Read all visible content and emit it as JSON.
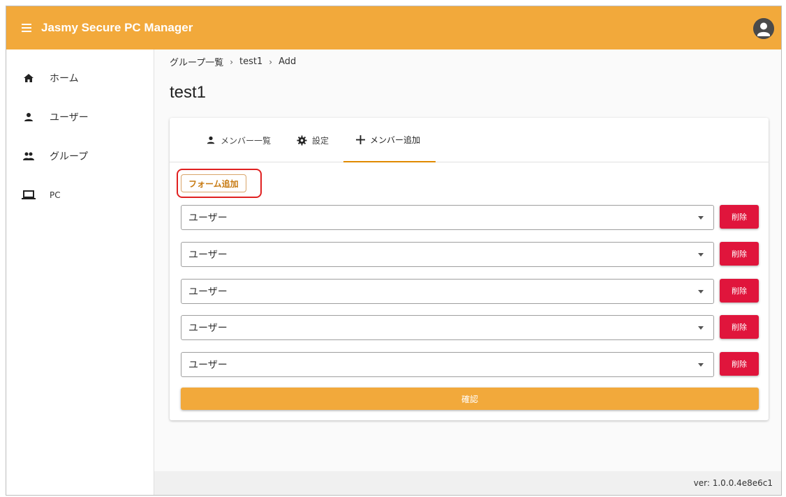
{
  "header": {
    "app_title": "Jasmy Secure PC Manager",
    "menu_icon": "hamburger-menu-icon",
    "avatar_icon": "account-circle-icon",
    "bar_color": "#f2a93b"
  },
  "sidebar": {
    "items": [
      {
        "label": "ホーム",
        "icon": "home-icon"
      },
      {
        "label": "ユーザー",
        "icon": "person-icon"
      },
      {
        "label": "グループ",
        "icon": "people-icon"
      },
      {
        "label": "PC",
        "icon": "laptop-icon"
      }
    ]
  },
  "breadcrumb": {
    "items": [
      "グループ一覧",
      "test1",
      "Add"
    ],
    "separator": "›"
  },
  "page": {
    "title": "test1"
  },
  "tabs": [
    {
      "label": "メンバー一覧",
      "icon": "person-icon"
    },
    {
      "label": "設定",
      "icon": "gear-icon"
    },
    {
      "label": "メンバー追加",
      "icon": "plus-icon"
    }
  ],
  "form": {
    "add_form_label": "フォーム追加",
    "rows": [
      {
        "select_value": "ユーザー",
        "delete_label": "削除"
      },
      {
        "select_value": "ユーザー",
        "delete_label": "削除"
      },
      {
        "select_value": "ユーザー",
        "delete_label": "削除"
      },
      {
        "select_value": "ユーザー",
        "delete_label": "削除"
      },
      {
        "select_value": "ユーザー",
        "delete_label": "削除"
      }
    ],
    "confirm_label": "確認",
    "delete_color": "#e0153c",
    "accent_color": "#f2a93b"
  },
  "footer": {
    "version": "ver: 1.0.0.4e8e6c1"
  }
}
